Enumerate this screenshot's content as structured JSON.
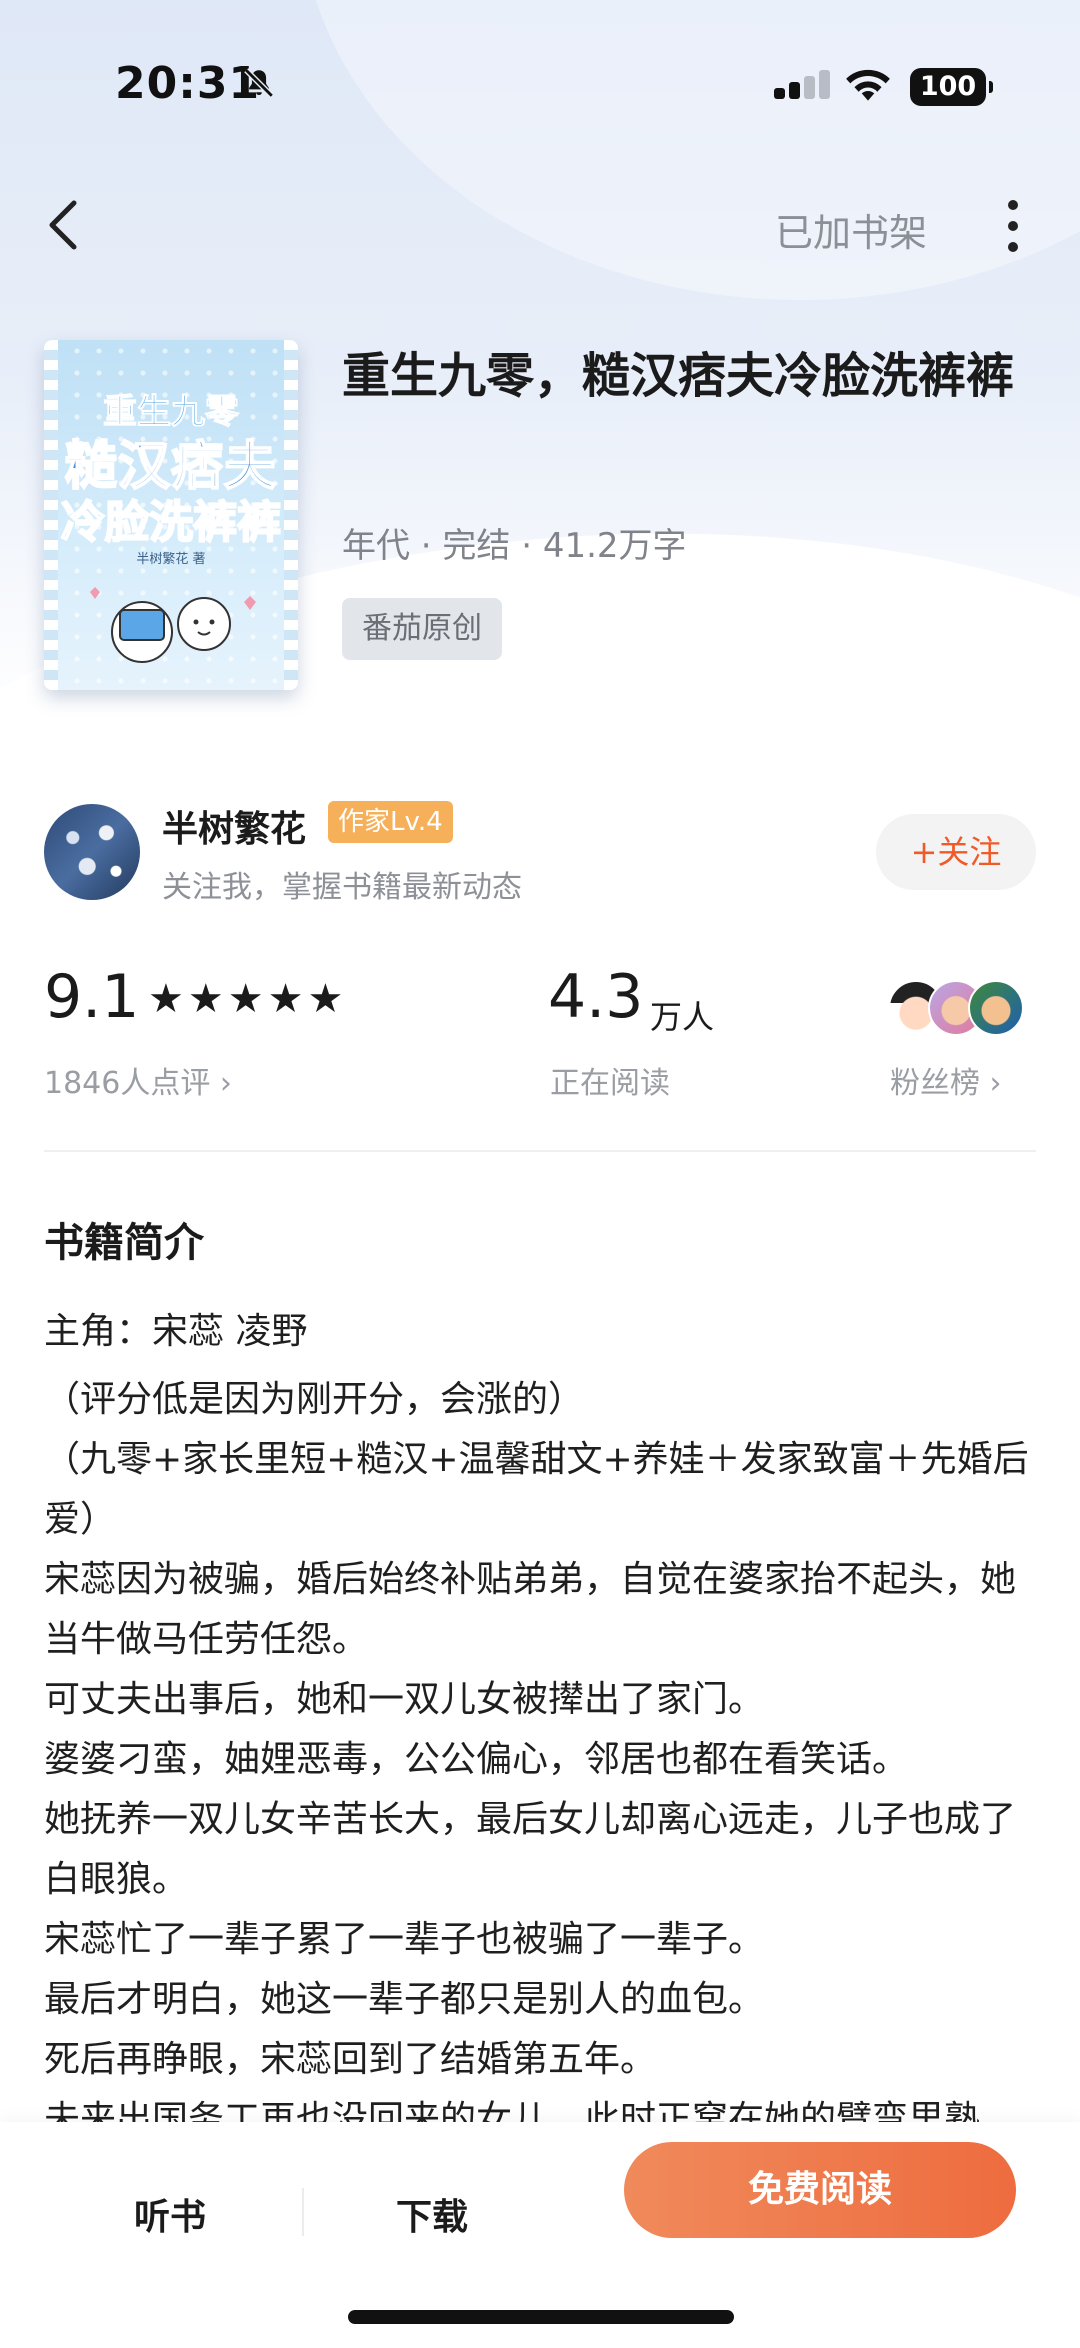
{
  "status_bar": {
    "time": "20:31",
    "battery": "100"
  },
  "nav": {
    "shelf_label": "已加书架"
  },
  "book": {
    "cover": {
      "line1": "重生九零",
      "line2": "糙汉痞夫",
      "line3": "冷脸洗裤裤",
      "author_line": "半树繁花 著"
    },
    "title": "重生九零，糙汉痞夫冷脸洗裤裤",
    "meta": "年代 · 完结 · 41.2万字",
    "source_tag": "番茄原创"
  },
  "author": {
    "name": "半树繁花",
    "level": "作家Lv.4",
    "desc": "关注我，掌握书籍最新动态",
    "follow_label": "+关注"
  },
  "stats": {
    "score": "9.1",
    "stars": "★★★★★",
    "stars_value": 5,
    "reviews": "1846人点评 ›",
    "readers_value": "4.3",
    "readers_unit": "万人",
    "readers_label": "正在阅读",
    "fans_label": "粉丝榜 ›"
  },
  "synopsis": {
    "section_title": "书籍简介",
    "lines": [
      "主角：宋蕊 凌野",
      "（评分低是因为刚开分，会涨的）",
      "（九零+家长里短+糙汉+温馨甜文+养娃＋发家致富＋先婚后爱）",
      "宋蕊因为被骗，婚后始终补贴弟弟，自觉在婆家抬不起头，她当牛做马任劳任怨。",
      "可丈夫出事后，她和一双儿女被撵出了家门。",
      "婆婆刁蛮，妯娌恶毒，公公偏心，邻居也都在看笑话。",
      "她抚养一双儿女辛苦长大，最后女儿却离心远走，儿子也成了白眼狼。",
      "宋蕊忙了一辈子累了一辈子也被骗了一辈子。",
      "最后才明白，她这一辈子都只是别人的血包。",
      "死后再睁眼，宋蕊回到了结婚第五年。",
      "未来出国务工再也没回来的女儿，此时正窝在她的臂弯里熟"
    ]
  },
  "bottom_bar": {
    "listen_label": "听书",
    "download_label": "下载",
    "read_label": "免费阅读"
  },
  "colors": {
    "accent": "#ee6c3f",
    "level_badge": "#f7b05a",
    "muted_text": "#9a9ea4"
  },
  "icons": {
    "back": "chevron-left-icon",
    "more": "more-vertical-icon",
    "bell_off": "bell-slash-icon",
    "wifi": "wifi-icon",
    "signal": "cellular-signal-icon"
  }
}
